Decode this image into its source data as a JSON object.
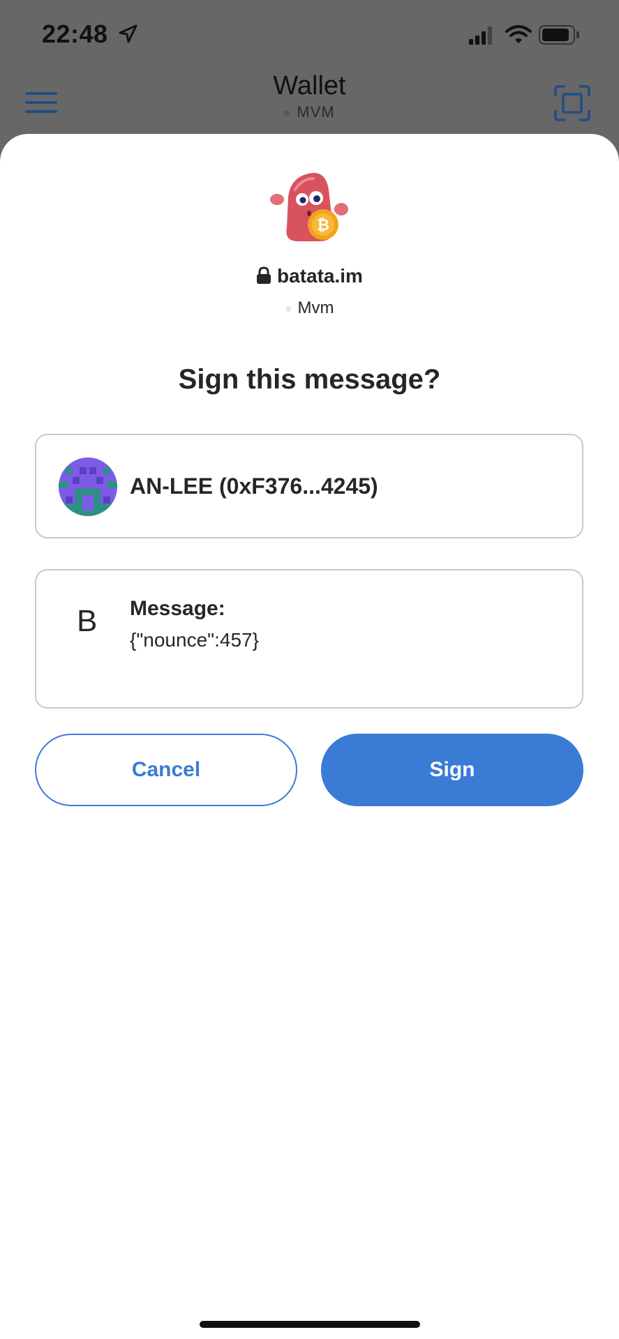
{
  "status_bar": {
    "time": "22:48"
  },
  "nav": {
    "title": "Wallet",
    "network": "MVM"
  },
  "dapp": {
    "host": "batata.im",
    "network": "Mvm"
  },
  "sheet": {
    "title": "Sign this message?"
  },
  "account": {
    "label": "AN-LEE (0xF376...4245)"
  },
  "message": {
    "letter": "B",
    "heading": "Message:",
    "body": "{\"nounce\":457}"
  },
  "buttons": {
    "cancel": "Cancel",
    "sign": "Sign"
  },
  "colors": {
    "accent": "#3a7bd5",
    "backdrop": "#676767",
    "text": "#24272a",
    "card_border": "#c9c9c9"
  },
  "icons": {
    "menu": "menu-icon",
    "scan": "scan-icon",
    "lock": "lock-icon",
    "location": "location-arrow-icon",
    "signal": "signal-icon",
    "wifi": "wifi-icon",
    "battery": "battery-icon"
  }
}
